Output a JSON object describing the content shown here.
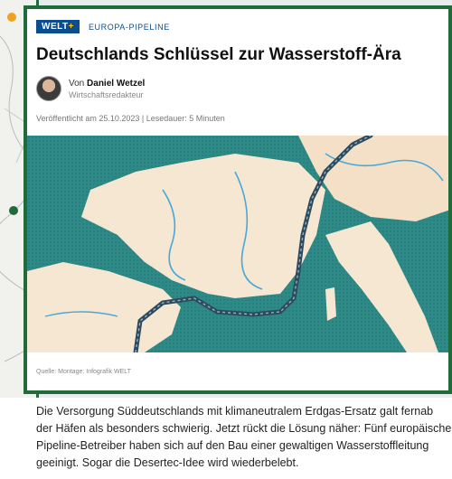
{
  "brand": {
    "name": "WELT",
    "plus": "+"
  },
  "article": {
    "kicker": "EUROPA-PIPELINE",
    "title": "Deutschlands Schlüssel zur Wasserstoff-Ära",
    "author_prefix": "Von",
    "author": "Daniel Wetzel",
    "author_role": "Wirtschaftsredakteur",
    "meta": "Veröffentlicht am 25.10.2023 | Lesedauer: 5 Minuten",
    "image_credit": "Quelle: Montage: Infografik WELT",
    "lead": "Die Versorgung Süddeutschlands mit klimaneutralem Erdgas-Ersatz galt fernab der Häfen als besonders schwierig. Jetzt rückt die Lösung näher: Fünf europäische Pipeline-Betreiber haben sich auf den Bau einer gewaltigen Wasserstoffleitung geeinigt. Sogar die Desertec-Idee wird wiederbelebt."
  },
  "colors": {
    "accent": "#1f6b3a",
    "brand_blue": "#0a4e8f",
    "sea": "#2e8a87",
    "land": "#f6e7d2",
    "pipeline": "#2f4a5c"
  }
}
